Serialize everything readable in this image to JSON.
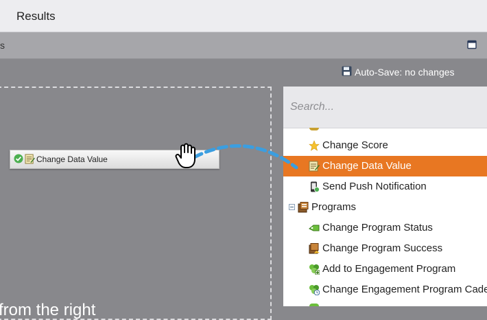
{
  "header": {
    "title": "Results"
  },
  "toolbar": {
    "left_fragment": "s"
  },
  "autosave": {
    "label": "Auto-Save: no changes"
  },
  "canvas": {
    "drop_hint": "from the right",
    "step_label": "Change Data Value"
  },
  "panel": {
    "search_placeholder": "Search...",
    "items": [
      {
        "label": "Change Score",
        "icon": "star-icon"
      },
      {
        "label": "Change Data Value",
        "icon": "data-value-icon",
        "selected": true
      },
      {
        "label": "Send Push Notification",
        "icon": "push-notification-icon"
      },
      {
        "label": "Programs",
        "icon": "programs-icon",
        "category": true
      },
      {
        "label": "Change Program Status",
        "icon": "program-status-icon"
      },
      {
        "label": "Change Program Success",
        "icon": "program-success-icon"
      },
      {
        "label": "Add to Engagement Program",
        "icon": "add-engagement-icon"
      },
      {
        "label": "Change Engagement Program Caden",
        "icon": "engagement-cadence-icon"
      }
    ]
  },
  "colors": {
    "selected": "#e87722",
    "canvas": "#88888c",
    "drag_line": "#3b9ee0"
  }
}
